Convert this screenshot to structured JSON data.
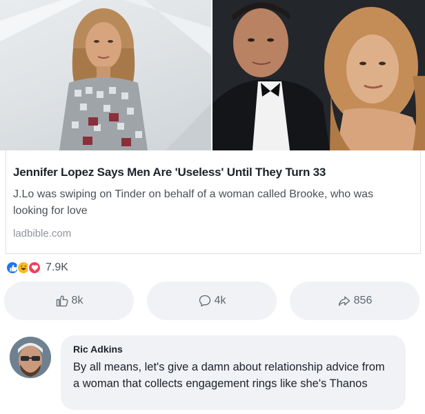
{
  "post": {
    "link": {
      "title": "Jennifer Lopez Says Men Are 'Useless' Until They Turn 33",
      "description": "J.Lo was swiping on Tinder on behalf of a woman called Brooke, who was looking for love",
      "domain": "ladbible.com"
    },
    "reactions": {
      "types": [
        "like",
        "haha",
        "love"
      ],
      "count": "7.9K"
    },
    "actions": {
      "like_count": "8k",
      "comment_count": "4k",
      "share_count": "856"
    }
  },
  "comment": {
    "author": "Ric Adkins",
    "text": "By all means,  let's give a damn about relationship advice from a woman that collects engagement rings like she's Thanos"
  },
  "colors": {
    "like_blue": "#1877f2",
    "haha_yellow": "#f7b928",
    "love_red": "#f33e58",
    "bubble_gray": "#f0f2f5"
  }
}
